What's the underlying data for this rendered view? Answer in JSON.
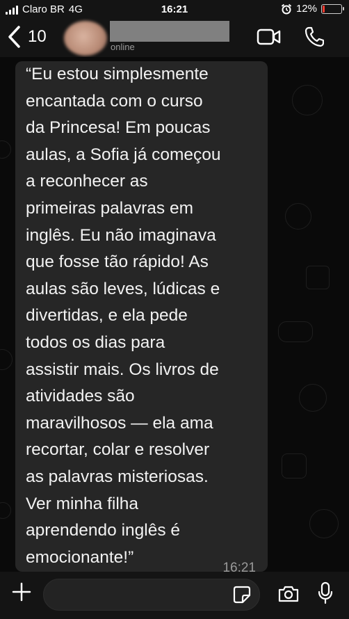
{
  "status_bar": {
    "carrier": "Claro BR",
    "network": "4G",
    "time": "16:21",
    "battery_percent": "12%",
    "battery_level": 0.12,
    "icons": [
      "signal-icon",
      "alarm-icon",
      "battery-icon"
    ]
  },
  "header": {
    "back_count": "10",
    "contact_name": "",
    "contact_status": "online",
    "icons": [
      "back-chevron-icon",
      "video-camera-icon",
      "phone-icon"
    ]
  },
  "chat": {
    "message": {
      "text": "“Eu estou simplesmente\nencantada com o curso\nda Princesa! Em poucas\naulas, a Sofia já começou\na reconhecer as\nprimeiras palavras em\ninglês. Eu não imaginava\nque fosse tão rápido! As\naulas são leves, lúdicas e\ndivertidas, e ela pede\ntodos os dias para\nassistir mais. Os livros de\natividades são\nmaravilhosos — ela ama\nrecortar, colar e resolver\nas palavras misteriosas.\nVer minha filha\naprendendo inglês é\nemocionante!”",
      "time": "16:21"
    }
  },
  "input_bar": {
    "placeholder": "",
    "icons": [
      "plus-icon",
      "sticker-icon",
      "camera-icon",
      "microphone-icon"
    ]
  },
  "colors": {
    "background": "#0a0a0a",
    "bar": "#141414",
    "bubble": "#262626",
    "battery_low": "#ff3b30"
  }
}
